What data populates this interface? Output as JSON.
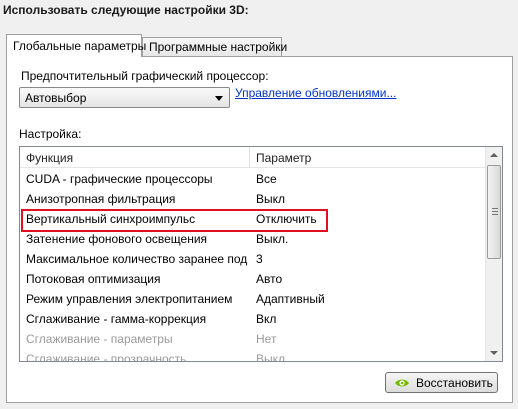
{
  "heading": "Использовать следующие настройки 3D:",
  "tabs": [
    {
      "label": "Глобальные параметры",
      "active": true
    },
    {
      "label": "Программные настройки",
      "active": false
    }
  ],
  "gpu": {
    "label": "Предпочтительный графический процессор:",
    "selected": "Автовыбор",
    "link": "Управление обновлениями..."
  },
  "settings": {
    "label": "Настройка:",
    "columns": [
      "Функция",
      "Параметр"
    ],
    "rows": [
      {
        "feature": "CUDA - графические процессоры",
        "value": "Все"
      },
      {
        "feature": "Анизотропная фильтрация",
        "value": "Выкл"
      },
      {
        "feature": "Вертикальный синхроимпульс",
        "value": "Отключить"
      },
      {
        "feature": "Затенение фонового освещения",
        "value": "Выкл."
      },
      {
        "feature": "Максимальное количество заранее под...",
        "value": "3"
      },
      {
        "feature": "Потоковая оптимизация",
        "value": "Авто"
      },
      {
        "feature": "Режим управления электропитанием",
        "value": "Адаптивный"
      },
      {
        "feature": "Сглаживание - гамма-коррекция",
        "value": "Вкл"
      },
      {
        "feature": "Сглаживание - параметры",
        "value": "Нет"
      },
      {
        "feature": "Сглаживание - прозрачность",
        "value": "Выкл"
      }
    ]
  },
  "restore_button": "Восстановить",
  "colors": {
    "highlight_border": "#e01020",
    "link": "#0033cc",
    "nvidia_green": "#76b900"
  },
  "icons": {
    "dropdown": "chevron-down-icon",
    "restore": "nvidia-eye-icon"
  }
}
